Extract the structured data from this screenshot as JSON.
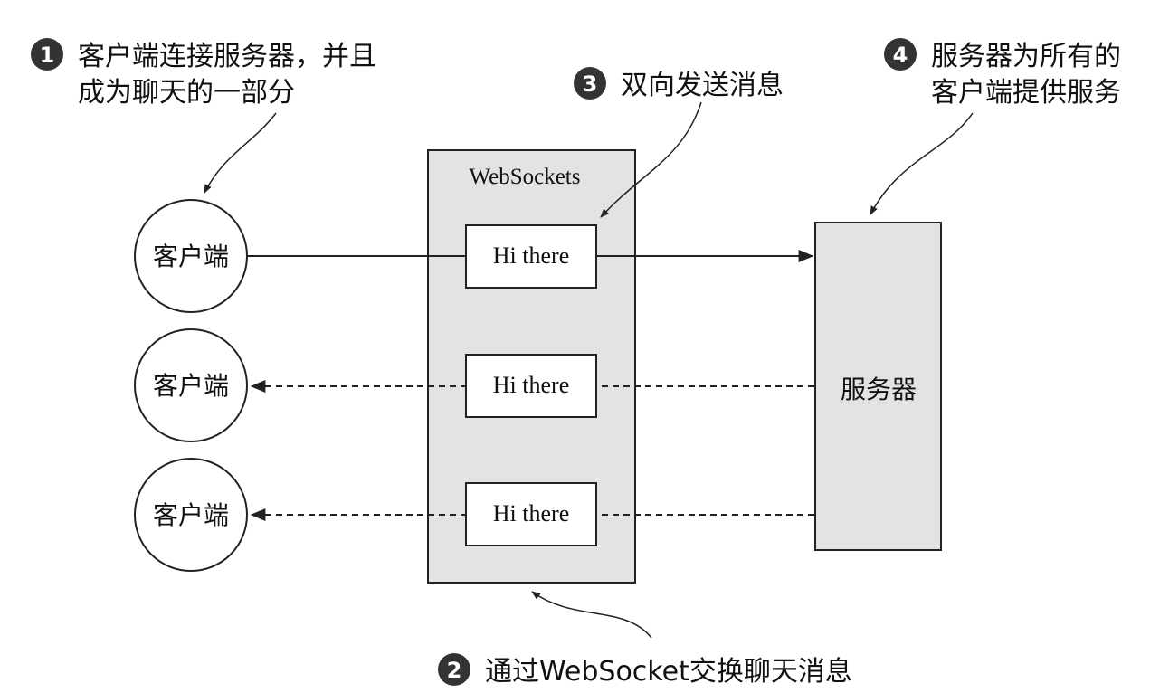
{
  "annotations": [
    {
      "number": "1",
      "lines": [
        "客户端连接服务器，并且",
        "成为聊天的一部分"
      ]
    },
    {
      "number": "2",
      "lines": [
        "通过WebSocket交换聊天消息"
      ]
    },
    {
      "number": "3",
      "lines": [
        "双向发送消息"
      ]
    },
    {
      "number": "4",
      "lines": [
        "服务器为所有的",
        "客户端提供服务"
      ]
    }
  ],
  "websocket_box": {
    "label": "WebSockets"
  },
  "clients": [
    {
      "label": "客户端"
    },
    {
      "label": "客户端"
    },
    {
      "label": "客户端"
    }
  ],
  "messages": [
    {
      "label": "Hi there"
    },
    {
      "label": "Hi there"
    },
    {
      "label": "Hi there"
    }
  ],
  "server": {
    "label": "服务器"
  },
  "colors": {
    "box_fill": "#e3e3e3",
    "stroke": "#222222",
    "badge": "#333333",
    "text": "#111111"
  }
}
